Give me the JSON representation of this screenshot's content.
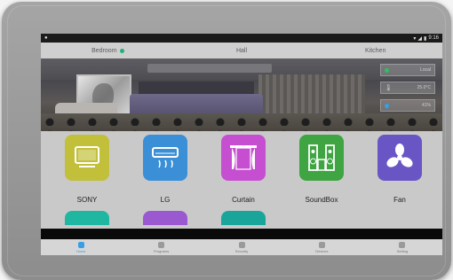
{
  "status_bar": {
    "time": "9:16"
  },
  "rooms": [
    {
      "label": "Bedroom",
      "active": true
    },
    {
      "label": "Hall",
      "active": false
    },
    {
      "label": "Kitchen",
      "active": false
    }
  ],
  "sensors": [
    {
      "label": "Local",
      "color": "#2fbf5f",
      "icon": "status-dot"
    },
    {
      "label": "25.0°C",
      "color": "#cfcfcf",
      "icon": "thermometer"
    },
    {
      "label": "41%",
      "color": "#3b9de6",
      "icon": "droplet"
    }
  ],
  "devices": [
    {
      "label": "SONY",
      "color": "#c2c03a",
      "icon": "tv-icon"
    },
    {
      "label": "LG",
      "color": "#3a8fd6",
      "icon": "air-conditioner-icon"
    },
    {
      "label": "Curtain",
      "color": "#c64fd1",
      "icon": "curtain-icon"
    },
    {
      "label": "SoundBox",
      "color": "#3fa442",
      "icon": "speaker-icon"
    },
    {
      "label": "Fan",
      "color": "#6a55c5",
      "icon": "fan-icon"
    }
  ],
  "devices_partial_colors": [
    "#1fb7a1",
    "#9a59d0",
    "#1aa59a"
  ],
  "nav": [
    {
      "label": "Home",
      "active": true
    },
    {
      "label": "Programs",
      "active": false
    },
    {
      "label": "Security",
      "active": false
    },
    {
      "label": "Devices",
      "active": false
    },
    {
      "label": "Setting",
      "active": false
    }
  ]
}
